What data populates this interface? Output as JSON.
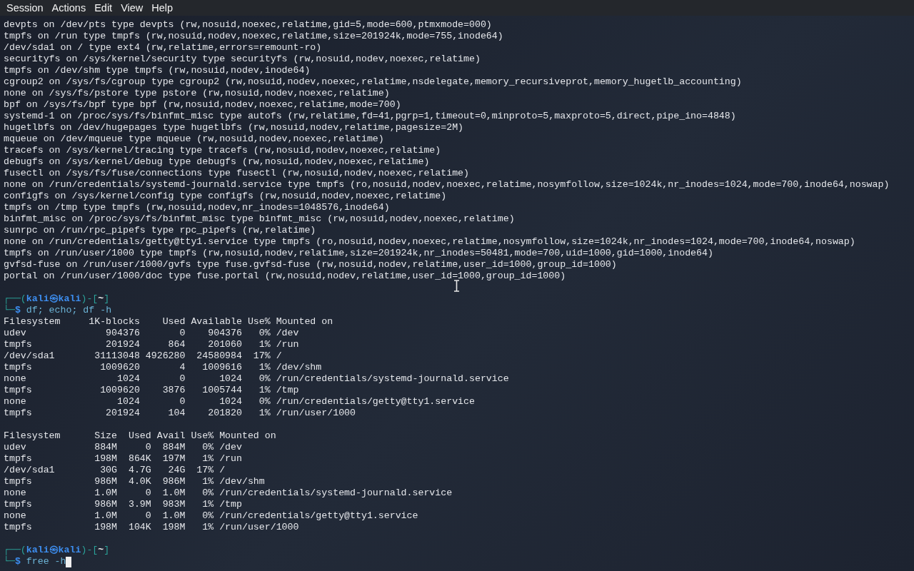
{
  "menu": [
    "Session",
    "Actions",
    "Edit",
    "View",
    "Help"
  ],
  "terminal": {
    "lines": [
      {
        "kind": "output",
        "text": "devpts on /dev/pts type devpts (rw,nosuid,noexec,relatime,gid=5,mode=600,ptmxmode=000)"
      },
      {
        "kind": "output",
        "text": "tmpfs on /run type tmpfs (rw,nosuid,nodev,noexec,relatime,size=201924k,mode=755,inode64)"
      },
      {
        "kind": "output",
        "text": "/dev/sda1 on / type ext4 (rw,relatime,errors=remount-ro)"
      },
      {
        "kind": "output",
        "text": "securityfs on /sys/kernel/security type securityfs (rw,nosuid,nodev,noexec,relatime)"
      },
      {
        "kind": "output",
        "text": "tmpfs on /dev/shm type tmpfs (rw,nosuid,nodev,inode64)"
      },
      {
        "kind": "output",
        "text": "cgroup2 on /sys/fs/cgroup type cgroup2 (rw,nosuid,nodev,noexec,relatime,nsdelegate,memory_recursiveprot,memory_hugetlb_accounting)"
      },
      {
        "kind": "output",
        "text": "none on /sys/fs/pstore type pstore (rw,nosuid,nodev,noexec,relatime)"
      },
      {
        "kind": "output",
        "text": "bpf on /sys/fs/bpf type bpf (rw,nosuid,nodev,noexec,relatime,mode=700)"
      },
      {
        "kind": "output",
        "text": "systemd-1 on /proc/sys/fs/binfmt_misc type autofs (rw,relatime,fd=41,pgrp=1,timeout=0,minproto=5,maxproto=5,direct,pipe_ino=4848)"
      },
      {
        "kind": "output",
        "text": "hugetlbfs on /dev/hugepages type hugetlbfs (rw,nosuid,nodev,relatime,pagesize=2M)"
      },
      {
        "kind": "output",
        "text": "mqueue on /dev/mqueue type mqueue (rw,nosuid,nodev,noexec,relatime)"
      },
      {
        "kind": "output",
        "text": "tracefs on /sys/kernel/tracing type tracefs (rw,nosuid,nodev,noexec,relatime)"
      },
      {
        "kind": "output",
        "text": "debugfs on /sys/kernel/debug type debugfs (rw,nosuid,nodev,noexec,relatime)"
      },
      {
        "kind": "output",
        "text": "fusectl on /sys/fs/fuse/connections type fusectl (rw,nosuid,nodev,noexec,relatime)"
      },
      {
        "kind": "output",
        "text": "none on /run/credentials/systemd-journald.service type tmpfs (ro,nosuid,nodev,noexec,relatime,nosymfollow,size=1024k,nr_inodes=1024,mode=700,inode64,noswap)"
      },
      {
        "kind": "output",
        "text": "configfs on /sys/kernel/config type configfs (rw,nosuid,nodev,noexec,relatime)"
      },
      {
        "kind": "output",
        "text": "tmpfs on /tmp type tmpfs (rw,nosuid,nodev,nr_inodes=1048576,inode64)"
      },
      {
        "kind": "output",
        "text": "binfmt_misc on /proc/sys/fs/binfmt_misc type binfmt_misc (rw,nosuid,nodev,noexec,relatime)"
      },
      {
        "kind": "output",
        "text": "sunrpc on /run/rpc_pipefs type rpc_pipefs (rw,relatime)"
      },
      {
        "kind": "output",
        "text": "none on /run/credentials/getty@tty1.service type tmpfs (ro,nosuid,nodev,noexec,relatime,nosymfollow,size=1024k,nr_inodes=1024,mode=700,inode64,noswap)"
      },
      {
        "kind": "output",
        "text": "tmpfs on /run/user/1000 type tmpfs (rw,nosuid,nodev,relatime,size=201924k,nr_inodes=50481,mode=700,uid=1000,gid=1000,inode64)"
      },
      {
        "kind": "output",
        "text": "gvfsd-fuse on /run/user/1000/gvfs type fuse.gvfsd-fuse (rw,nosuid,nodev,relatime,user_id=1000,group_id=1000)"
      },
      {
        "kind": "output",
        "text": "portal on /run/user/1000/doc type fuse.portal (rw,nosuid,nodev,relatime,user_id=1000,group_id=1000)"
      },
      {
        "kind": "blank"
      },
      {
        "kind": "prompt",
        "open": "┌──(",
        "user_host": "kali㉿kali",
        "mid": ")-[",
        "dir": "~",
        "close": "]"
      },
      {
        "kind": "command",
        "lead": "└─",
        "symbol": "$",
        "command": "df; echo; df -h",
        "cursor": false
      },
      {
        "kind": "output",
        "text": "Filesystem     1K-blocks    Used Available Use% Mounted on"
      },
      {
        "kind": "output",
        "text": "udev              904376       0    904376   0% /dev"
      },
      {
        "kind": "output",
        "text": "tmpfs             201924     864    201060   1% /run"
      },
      {
        "kind": "output",
        "text": "/dev/sda1       31113048 4926280  24580984  17% /"
      },
      {
        "kind": "output",
        "text": "tmpfs            1009620       4   1009616   1% /dev/shm"
      },
      {
        "kind": "output",
        "text": "none                1024       0      1024   0% /run/credentials/systemd-journald.service"
      },
      {
        "kind": "output",
        "text": "tmpfs            1009620    3876   1005744   1% /tmp"
      },
      {
        "kind": "output",
        "text": "none                1024       0      1024   0% /run/credentials/getty@tty1.service"
      },
      {
        "kind": "output",
        "text": "tmpfs             201924     104    201820   1% /run/user/1000"
      },
      {
        "kind": "blank"
      },
      {
        "kind": "output",
        "text": "Filesystem      Size  Used Avail Use% Mounted on"
      },
      {
        "kind": "output",
        "text": "udev            884M     0  884M   0% /dev"
      },
      {
        "kind": "output",
        "text": "tmpfs           198M  864K  197M   1% /run"
      },
      {
        "kind": "output",
        "text": "/dev/sda1        30G  4.7G   24G  17% /"
      },
      {
        "kind": "output",
        "text": "tmpfs           986M  4.0K  986M   1% /dev/shm"
      },
      {
        "kind": "output",
        "text": "none            1.0M     0  1.0M   0% /run/credentials/systemd-journald.service"
      },
      {
        "kind": "output",
        "text": "tmpfs           986M  3.9M  983M   1% /tmp"
      },
      {
        "kind": "output",
        "text": "none            1.0M     0  1.0M   0% /run/credentials/getty@tty1.service"
      },
      {
        "kind": "output",
        "text": "tmpfs           198M  104K  198M   1% /run/user/1000"
      },
      {
        "kind": "blank"
      },
      {
        "kind": "prompt",
        "open": "┌──(",
        "user_host": "kali㉿kali",
        "mid": ")-[",
        "dir": "~",
        "close": "]"
      },
      {
        "kind": "command",
        "lead": "└─",
        "symbol": "$",
        "command": "free -h",
        "cursor": true
      }
    ]
  }
}
